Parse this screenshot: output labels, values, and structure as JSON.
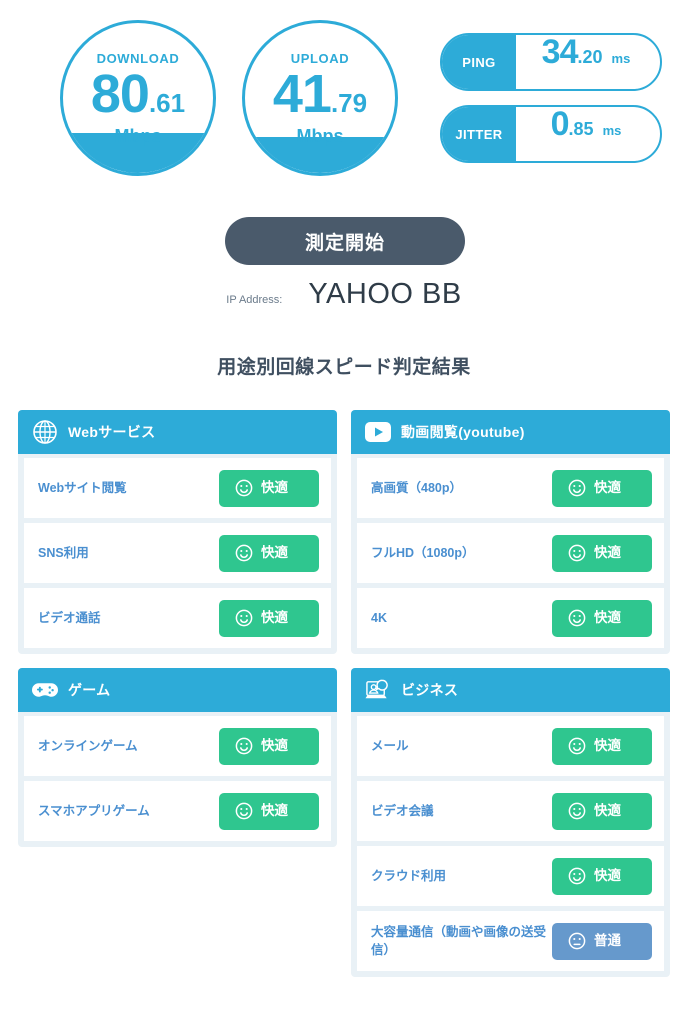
{
  "metrics": {
    "download": {
      "label": "DOWNLOAD",
      "int": "80",
      "dec": ".61",
      "unit": "Mbps",
      "value": 80.61,
      "fill_percent": 28
    },
    "upload": {
      "label": "UPLOAD",
      "int": "41",
      "dec": ".79",
      "unit": "Mbps",
      "value": 41.79,
      "fill_percent": 26
    },
    "ping": {
      "label": "PING",
      "int": "34",
      "dec": ".20",
      "unit": "ms",
      "value": 34.2
    },
    "jitter": {
      "label": "JITTER",
      "int": "0",
      "dec": ".85",
      "unit": "ms",
      "value": 0.85
    }
  },
  "actions": {
    "start_label": "測定開始"
  },
  "ip": {
    "caption": "IP Address:",
    "value": "YAHOO BB"
  },
  "section": {
    "title": "用途別回線スピード判定結果"
  },
  "colors": {
    "accent_blue": "#2dabd8",
    "good_green": "#2fc68f",
    "average_blue": "#6699cc",
    "button_dark": "#4a5a6b",
    "card_bg": "#e9f1f6",
    "label_blue": "#4a8fd0"
  },
  "cards": [
    {
      "icon": "globe-icon",
      "title": "Webサービス",
      "rows": [
        {
          "label": "Webサイト閲覧",
          "verdict": "快適",
          "rating": "good",
          "face": "smile-icon"
        },
        {
          "label": "SNS利用",
          "verdict": "快適",
          "rating": "good",
          "face": "smile-icon"
        },
        {
          "label": "ビデオ通話",
          "verdict": "快適",
          "rating": "good",
          "face": "smile-icon"
        }
      ]
    },
    {
      "icon": "play-button-icon",
      "title": "動画閲覧(youtube)",
      "rows": [
        {
          "label": "高画質（480p）",
          "verdict": "快適",
          "rating": "good",
          "face": "smile-icon"
        },
        {
          "label": "フルHD（1080p）",
          "verdict": "快適",
          "rating": "good",
          "face": "smile-icon"
        },
        {
          "label": "4K",
          "verdict": "快適",
          "rating": "good",
          "face": "smile-icon"
        }
      ]
    },
    {
      "icon": "gamepad-icon",
      "title": "ゲーム",
      "rows": [
        {
          "label": "オンラインゲーム",
          "verdict": "快適",
          "rating": "good",
          "face": "smile-icon"
        },
        {
          "label": "スマホアプリゲーム",
          "verdict": "快適",
          "rating": "good",
          "face": "smile-icon"
        }
      ]
    },
    {
      "icon": "video-conference-icon",
      "title": "ビジネス",
      "rows": [
        {
          "label": "メール",
          "verdict": "快適",
          "rating": "good",
          "face": "smile-icon"
        },
        {
          "label": "ビデオ会議",
          "verdict": "快適",
          "rating": "good",
          "face": "smile-icon"
        },
        {
          "label": "クラウド利用",
          "verdict": "快適",
          "rating": "good",
          "face": "smile-icon"
        },
        {
          "label": "大容量通信（動画や画像の送受信）",
          "verdict": "普通",
          "rating": "average",
          "face": "neutral-icon"
        }
      ]
    }
  ]
}
